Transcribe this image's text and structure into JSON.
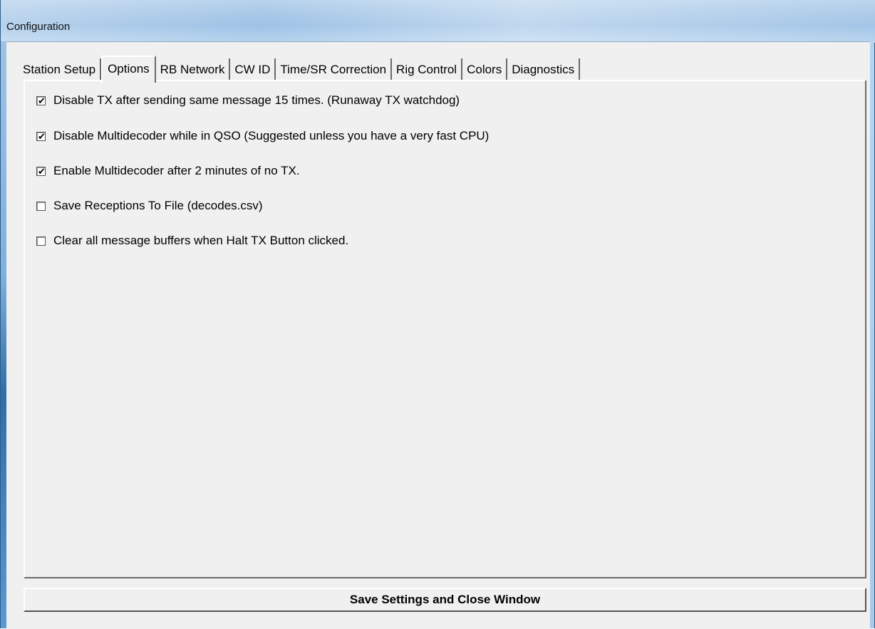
{
  "window": {
    "title": "Configuration"
  },
  "tabs": [
    {
      "label": "Station Setup",
      "active": false
    },
    {
      "label": "Options",
      "active": true
    },
    {
      "label": "RB Network",
      "active": false
    },
    {
      "label": "CW ID",
      "active": false
    },
    {
      "label": "Time/SR Correction",
      "active": false
    },
    {
      "label": "Rig Control",
      "active": false
    },
    {
      "label": "Colors",
      "active": false
    },
    {
      "label": "Diagnostics",
      "active": false
    }
  ],
  "options": [
    {
      "label": "Disable TX after sending same message 15 times. (Runaway TX watchdog)",
      "checked": true
    },
    {
      "label": "Disable Multidecoder while in QSO (Suggested unless you have a very fast CPU)",
      "checked": true
    },
    {
      "label": "Enable Multidecoder after 2 minutes of no TX.",
      "checked": true
    },
    {
      "label": "Save Receptions To File (decodes.csv)",
      "checked": false
    },
    {
      "label": "Clear all message buffers when Halt TX Button clicked.",
      "checked": false
    }
  ],
  "footer": {
    "save_label": "Save Settings and Close Window"
  },
  "checkmark_glyph": "✔",
  "colors": {
    "titlebar": "#a9c9e8",
    "client_bg": "#f0f0f0"
  }
}
